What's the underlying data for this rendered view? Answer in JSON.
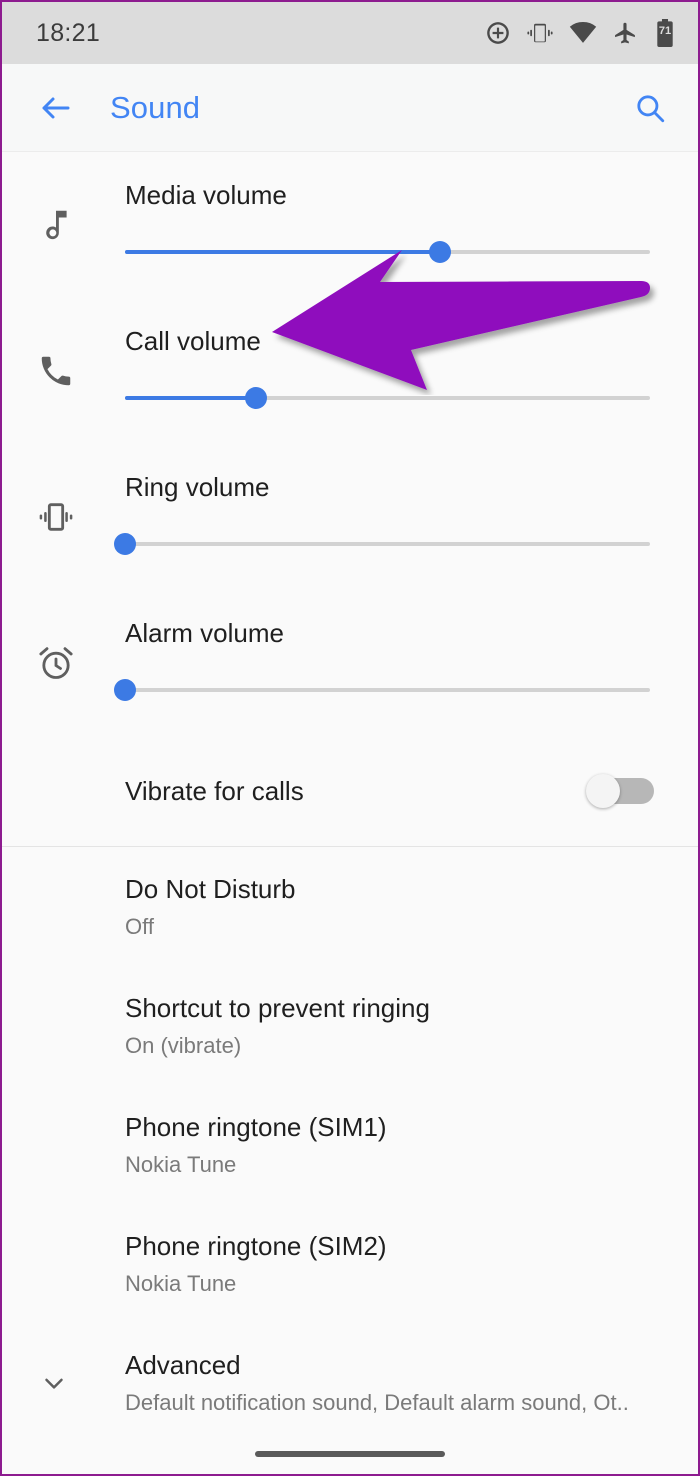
{
  "statusbar": {
    "time": "18:21",
    "battery_level": "71",
    "icons": [
      {
        "name": "dnd-add-icon",
        "label": "do-not-disturb"
      },
      {
        "name": "vibrate-icon",
        "label": "vibrate"
      },
      {
        "name": "wifi-icon",
        "label": "wifi"
      },
      {
        "name": "airplane-mode-icon",
        "label": "airplane mode"
      },
      {
        "name": "battery-icon",
        "label": "battery 71"
      }
    ]
  },
  "appbar": {
    "title": "Sound",
    "back_label": "Back",
    "search_label": "Search",
    "accent_color": "#4285f4"
  },
  "volumes": [
    {
      "label": "Media volume",
      "icon": "music-note-icon",
      "value": 60
    },
    {
      "label": "Call volume",
      "icon": "phone-icon",
      "value": 25
    },
    {
      "label": "Ring volume",
      "icon": "vibrate-icon",
      "value": 0
    },
    {
      "label": "Alarm volume",
      "icon": "alarm-clock-icon",
      "value": 0
    }
  ],
  "vibrate_for_calls": {
    "label": "Vibrate for calls",
    "state": "off"
  },
  "list_items": [
    {
      "title": "Do Not Disturb",
      "subtitle": "Off"
    },
    {
      "title": "Shortcut to prevent ringing",
      "subtitle": "On (vibrate)"
    },
    {
      "title": "Phone ringtone (SIM1)",
      "subtitle": "Nokia Tune"
    },
    {
      "title": "Phone ringtone (SIM2)",
      "subtitle": "Nokia Tune"
    },
    {
      "title": "Advanced",
      "subtitle": "Default notification sound, Default alarm sound, Ot.."
    }
  ],
  "annotation": {
    "type": "arrow",
    "direction": "left",
    "color": "#8f11bd"
  }
}
